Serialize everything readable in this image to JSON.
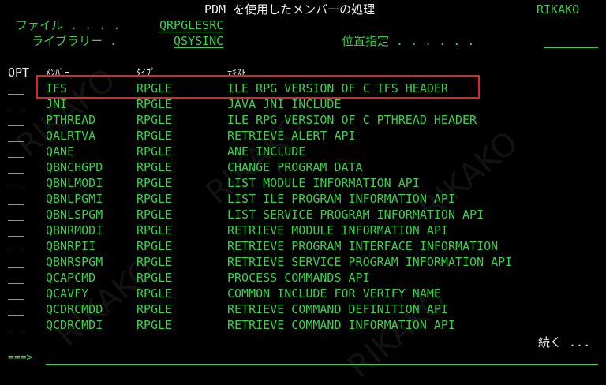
{
  "header": {
    "title": "PDM を使用したメンバーの処理",
    "system": "RIKAKO",
    "file_label": "ファイル . . . .",
    "file_value": "QRPGLESRC",
    "library_label": "ライブラリー .",
    "library_value": "QSYSINC",
    "position_label": "位置指定 . . . . . ."
  },
  "columns": {
    "opt": "OPT",
    "member": "ﾒﾝﾊﾞｰ",
    "type": "ﾀｲﾌﾟ",
    "text": "ﾃｷｽﾄ"
  },
  "rows": [
    {
      "member": "IFS",
      "type": "RPGLE",
      "text": "ILE RPG VERSION OF C IFS HEADER"
    },
    {
      "member": "JNI",
      "type": "RPGLE",
      "text": "JAVA JNI INCLUDE"
    },
    {
      "member": "PTHREAD",
      "type": "RPGLE",
      "text": "ILE RPG VERSION OF C PTHREAD HEADER"
    },
    {
      "member": "QALRTVA",
      "type": "RPGLE",
      "text": "RETRIEVE ALERT API"
    },
    {
      "member": "QANE",
      "type": "RPGLE",
      "text": "ANE INCLUDE"
    },
    {
      "member": "QBNCHGPD",
      "type": "RPGLE",
      "text": "CHANGE PROGRAM DATA"
    },
    {
      "member": "QBNLMODI",
      "type": "RPGLE",
      "text": "LIST MODULE INFORMATION API"
    },
    {
      "member": "QBNLPGMI",
      "type": "RPGLE",
      "text": "LIST ILE PROGRAM INFORMATION API"
    },
    {
      "member": "QBNLSPGM",
      "type": "RPGLE",
      "text": "LIST SERVICE PROGRAM INFORMATION API"
    },
    {
      "member": "QBNRMODI",
      "type": "RPGLE",
      "text": "RETRIEVE MODULE INFORMATION API"
    },
    {
      "member": "QBNRPII",
      "type": "RPGLE",
      "text": "RETRIEVE PROGRAM INTERFACE INFORMATION"
    },
    {
      "member": "QBNRSPGM",
      "type": "RPGLE",
      "text": "RETRIEVE SERVICE PROGRAM INFORMATION API"
    },
    {
      "member": "QCAPCMD",
      "type": "RPGLE",
      "text": "PROCESS COMMANDS API"
    },
    {
      "member": "QCAVFY",
      "type": "RPGLE",
      "text": "COMMON INCLUDE FOR VERIFY NAME"
    },
    {
      "member": "QCDRCMDD",
      "type": "RPGLE",
      "text": "RETRIEVE COMMAND DEFINITION API"
    },
    {
      "member": "QCDRCMDI",
      "type": "RPGLE",
      "text": "RETRIEVE COMMAND INFORMATION API"
    }
  ],
  "more": "続く ...",
  "command": {
    "prompt": "===>"
  },
  "watermark": "RIKAKO",
  "colors": {
    "green": "#35d24a",
    "white": "#eef2ee",
    "highlight": "#e2232b",
    "background": "#000000"
  }
}
